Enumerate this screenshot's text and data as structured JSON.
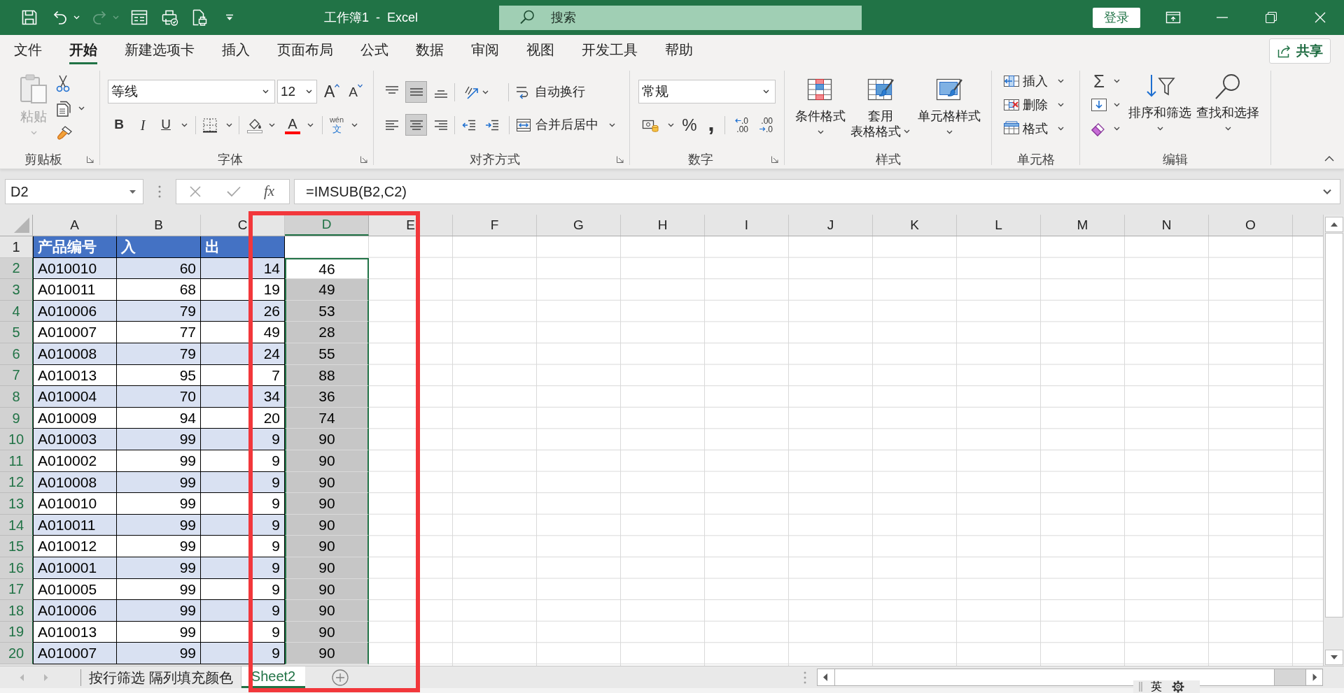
{
  "title_bar": {
    "title": "工作簿1  -  Excel",
    "search": {
      "placeholder": "搜索"
    },
    "sign_in": "登录"
  },
  "tabs": [
    {
      "label": "文件",
      "selected": false
    },
    {
      "label": "开始",
      "selected": true
    },
    {
      "label": "新建选项卡",
      "selected": false
    },
    {
      "label": "插入",
      "selected": false
    },
    {
      "label": "页面布局",
      "selected": false
    },
    {
      "label": "公式",
      "selected": false
    },
    {
      "label": "数据",
      "selected": false
    },
    {
      "label": "审阅",
      "selected": false
    },
    {
      "label": "视图",
      "selected": false
    },
    {
      "label": "开发工具",
      "selected": false
    },
    {
      "label": "帮助",
      "selected": false
    }
  ],
  "share_button": "共享",
  "ribbon": {
    "clipboard": {
      "label": "剪贴板",
      "paste": {
        "label": "粘贴",
        "disabled": true
      }
    },
    "font": {
      "label": "字体",
      "family": "等线",
      "size": "12",
      "grow": "A",
      "shrink": "A",
      "bold": "B",
      "italic": "I",
      "underline": "U",
      "font_color": "A",
      "phonetic": {
        "reading": "wén",
        "character": "文"
      }
    },
    "alignment": {
      "label": "对齐方式",
      "vertical": [
        {
          "kind": "top",
          "selected": false
        },
        {
          "kind": "middle",
          "selected": true
        },
        {
          "kind": "bottom",
          "selected": false
        }
      ],
      "horizontal": [
        {
          "kind": "left",
          "selected": false
        },
        {
          "kind": "center",
          "selected": true
        },
        {
          "kind": "right",
          "selected": false
        }
      ],
      "wrap_text": "自动换行",
      "merge": "合并后居中"
    },
    "number": {
      "label": "数字",
      "format": "常规",
      "percent": "%",
      "comma": ",",
      "increase_decimal": [
        ".0",
        ".00"
      ],
      "decrease_decimal": [
        ".00",
        ".0"
      ]
    },
    "styles": {
      "label": "样式",
      "buttons": [
        {
          "kind": "conditional",
          "lines": [
            "条件格式"
          ]
        },
        {
          "kind": "table",
          "lines": [
            "套用",
            "表格格式"
          ]
        },
        {
          "kind": "cell",
          "lines": [
            "单元格样式"
          ]
        }
      ]
    },
    "cells": {
      "label": "单元格",
      "buttons": [
        {
          "kind": "insert",
          "label": "插入"
        },
        {
          "kind": "delete",
          "label": "删除"
        },
        {
          "kind": "format",
          "label": "格式"
        }
      ]
    },
    "editing": {
      "label": "编辑",
      "sum": "Σ",
      "sort": "排序和筛选",
      "find": "查找和选择"
    }
  },
  "formula_bar": {
    "name_box": "D2",
    "fx": "fx",
    "formula": "=IMSUB(B2,C2)"
  },
  "sheet": {
    "columns": [
      {
        "label": "A",
        "selected": false
      },
      {
        "label": "B",
        "selected": false
      },
      {
        "label": "C",
        "selected": false
      },
      {
        "label": "D",
        "selected": true
      },
      {
        "label": "E",
        "selected": false
      },
      {
        "label": "F",
        "selected": false
      },
      {
        "label": "G",
        "selected": false
      },
      {
        "label": "H",
        "selected": false
      },
      {
        "label": "I",
        "selected": false
      },
      {
        "label": "J",
        "selected": false
      },
      {
        "label": "K",
        "selected": false
      },
      {
        "label": "L",
        "selected": false
      },
      {
        "label": "M",
        "selected": false
      },
      {
        "label": "N",
        "selected": false
      },
      {
        "label": "O",
        "selected": false
      }
    ],
    "header_row": {
      "label": "1",
      "selected": false,
      "cells": [
        "产品编号",
        "入",
        "出"
      ]
    },
    "rows": [
      {
        "label": "2",
        "cells": [
          "A010010",
          "60",
          "14",
          "46"
        ],
        "shaded": true,
        "selected": true,
        "active": true
      },
      {
        "label": "3",
        "cells": [
          "A010011",
          "68",
          "19",
          "49"
        ],
        "shaded": false,
        "selected": true,
        "active": false
      },
      {
        "label": "4",
        "cells": [
          "A010006",
          "79",
          "26",
          "53"
        ],
        "shaded": true,
        "selected": true,
        "active": false
      },
      {
        "label": "5",
        "cells": [
          "A010007",
          "77",
          "49",
          "28"
        ],
        "shaded": false,
        "selected": true,
        "active": false
      },
      {
        "label": "6",
        "cells": [
          "A010008",
          "79",
          "24",
          "55"
        ],
        "shaded": true,
        "selected": true,
        "active": false
      },
      {
        "label": "7",
        "cells": [
          "A010013",
          "95",
          "7",
          "88"
        ],
        "shaded": false,
        "selected": true,
        "active": false
      },
      {
        "label": "8",
        "cells": [
          "A010004",
          "70",
          "34",
          "36"
        ],
        "shaded": true,
        "selected": true,
        "active": false
      },
      {
        "label": "9",
        "cells": [
          "A010009",
          "94",
          "20",
          "74"
        ],
        "shaded": false,
        "selected": true,
        "active": false
      },
      {
        "label": "10",
        "cells": [
          "A010003",
          "99",
          "9",
          "90"
        ],
        "shaded": true,
        "selected": true,
        "active": false
      },
      {
        "label": "11",
        "cells": [
          "A010002",
          "99",
          "9",
          "90"
        ],
        "shaded": false,
        "selected": true,
        "active": false
      },
      {
        "label": "12",
        "cells": [
          "A010008",
          "99",
          "9",
          "90"
        ],
        "shaded": true,
        "selected": true,
        "active": false
      },
      {
        "label": "13",
        "cells": [
          "A010010",
          "99",
          "9",
          "90"
        ],
        "shaded": false,
        "selected": true,
        "active": false
      },
      {
        "label": "14",
        "cells": [
          "A010011",
          "99",
          "9",
          "90"
        ],
        "shaded": true,
        "selected": true,
        "active": false
      },
      {
        "label": "15",
        "cells": [
          "A010012",
          "99",
          "9",
          "90"
        ],
        "shaded": false,
        "selected": true,
        "active": false
      },
      {
        "label": "16",
        "cells": [
          "A010001",
          "99",
          "9",
          "90"
        ],
        "shaded": true,
        "selected": true,
        "active": false
      },
      {
        "label": "17",
        "cells": [
          "A010005",
          "99",
          "9",
          "90"
        ],
        "shaded": false,
        "selected": true,
        "active": false
      },
      {
        "label": "18",
        "cells": [
          "A010006",
          "99",
          "9",
          "90"
        ],
        "shaded": true,
        "selected": true,
        "active": false
      },
      {
        "label": "19",
        "cells": [
          "A010013",
          "99",
          "9",
          "90"
        ],
        "shaded": false,
        "selected": true,
        "active": false
      },
      {
        "label": "20",
        "cells": [
          "A010007",
          "99",
          "9",
          "90"
        ],
        "shaded": true,
        "selected": true,
        "active": false
      }
    ]
  },
  "sheet_tabs": [
    {
      "label": "按行筛选 隔列填充颜色",
      "selected": false
    },
    {
      "label": "Sheet2",
      "selected": true
    }
  ],
  "input_method": {
    "mode": "英"
  },
  "annotations": [
    {
      "kind": "rectangle"
    }
  ]
}
